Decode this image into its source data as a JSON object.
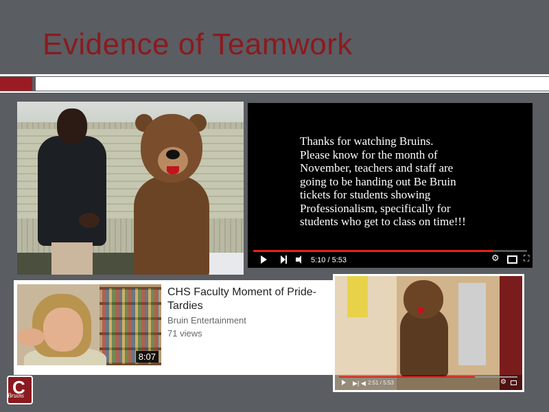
{
  "slide": {
    "title": "Evidence of Teamwork",
    "colors": {
      "background": "#5a5d62",
      "title": "#8b1a1f",
      "accent": "#9c1b22"
    }
  },
  "video_main": {
    "message": "Thanks for watching Bruins.\nPlease know for the month of\nNovember, teachers and staff are\ngoing to be handing out  Be Bruin\ntickets for students  showing\nProfessionalism, specifically for\nstudents who get to class on time!!!",
    "time": "5:10 / 5:53",
    "progress": 0.876
  },
  "video_card": {
    "title": "CHS Faculty Moment of Pride- Tardies",
    "channel": "Bruin Entertainment",
    "views": "71 views",
    "duration": "8:07"
  },
  "video_small": {
    "time": "2:51 / 5:53",
    "progress": 0.76
  },
  "logo": {
    "letter": "C",
    "script": "Bruins"
  }
}
